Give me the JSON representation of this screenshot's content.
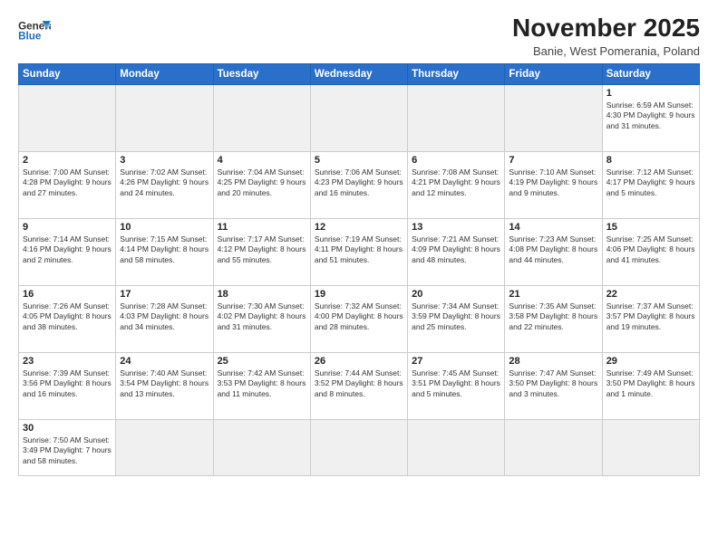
{
  "header": {
    "logo_text_regular": "General",
    "logo_text_blue": "Blue",
    "title": "November 2025",
    "subtitle": "Banie, West Pomerania, Poland"
  },
  "weekdays": [
    "Sunday",
    "Monday",
    "Tuesday",
    "Wednesday",
    "Thursday",
    "Friday",
    "Saturday"
  ],
  "weeks": [
    [
      {
        "day": "",
        "info": ""
      },
      {
        "day": "",
        "info": ""
      },
      {
        "day": "",
        "info": ""
      },
      {
        "day": "",
        "info": ""
      },
      {
        "day": "",
        "info": ""
      },
      {
        "day": "",
        "info": ""
      },
      {
        "day": "1",
        "info": "Sunrise: 6:59 AM\nSunset: 4:30 PM\nDaylight: 9 hours\nand 31 minutes."
      }
    ],
    [
      {
        "day": "2",
        "info": "Sunrise: 7:00 AM\nSunset: 4:28 PM\nDaylight: 9 hours\nand 27 minutes."
      },
      {
        "day": "3",
        "info": "Sunrise: 7:02 AM\nSunset: 4:26 PM\nDaylight: 9 hours\nand 24 minutes."
      },
      {
        "day": "4",
        "info": "Sunrise: 7:04 AM\nSunset: 4:25 PM\nDaylight: 9 hours\nand 20 minutes."
      },
      {
        "day": "5",
        "info": "Sunrise: 7:06 AM\nSunset: 4:23 PM\nDaylight: 9 hours\nand 16 minutes."
      },
      {
        "day": "6",
        "info": "Sunrise: 7:08 AM\nSunset: 4:21 PM\nDaylight: 9 hours\nand 12 minutes."
      },
      {
        "day": "7",
        "info": "Sunrise: 7:10 AM\nSunset: 4:19 PM\nDaylight: 9 hours\nand 9 minutes."
      },
      {
        "day": "8",
        "info": "Sunrise: 7:12 AM\nSunset: 4:17 PM\nDaylight: 9 hours\nand 5 minutes."
      }
    ],
    [
      {
        "day": "9",
        "info": "Sunrise: 7:14 AM\nSunset: 4:16 PM\nDaylight: 9 hours\nand 2 minutes."
      },
      {
        "day": "10",
        "info": "Sunrise: 7:15 AM\nSunset: 4:14 PM\nDaylight: 8 hours\nand 58 minutes."
      },
      {
        "day": "11",
        "info": "Sunrise: 7:17 AM\nSunset: 4:12 PM\nDaylight: 8 hours\nand 55 minutes."
      },
      {
        "day": "12",
        "info": "Sunrise: 7:19 AM\nSunset: 4:11 PM\nDaylight: 8 hours\nand 51 minutes."
      },
      {
        "day": "13",
        "info": "Sunrise: 7:21 AM\nSunset: 4:09 PM\nDaylight: 8 hours\nand 48 minutes."
      },
      {
        "day": "14",
        "info": "Sunrise: 7:23 AM\nSunset: 4:08 PM\nDaylight: 8 hours\nand 44 minutes."
      },
      {
        "day": "15",
        "info": "Sunrise: 7:25 AM\nSunset: 4:06 PM\nDaylight: 8 hours\nand 41 minutes."
      }
    ],
    [
      {
        "day": "16",
        "info": "Sunrise: 7:26 AM\nSunset: 4:05 PM\nDaylight: 8 hours\nand 38 minutes."
      },
      {
        "day": "17",
        "info": "Sunrise: 7:28 AM\nSunset: 4:03 PM\nDaylight: 8 hours\nand 34 minutes."
      },
      {
        "day": "18",
        "info": "Sunrise: 7:30 AM\nSunset: 4:02 PM\nDaylight: 8 hours\nand 31 minutes."
      },
      {
        "day": "19",
        "info": "Sunrise: 7:32 AM\nSunset: 4:00 PM\nDaylight: 8 hours\nand 28 minutes."
      },
      {
        "day": "20",
        "info": "Sunrise: 7:34 AM\nSunset: 3:59 PM\nDaylight: 8 hours\nand 25 minutes."
      },
      {
        "day": "21",
        "info": "Sunrise: 7:35 AM\nSunset: 3:58 PM\nDaylight: 8 hours\nand 22 minutes."
      },
      {
        "day": "22",
        "info": "Sunrise: 7:37 AM\nSunset: 3:57 PM\nDaylight: 8 hours\nand 19 minutes."
      }
    ],
    [
      {
        "day": "23",
        "info": "Sunrise: 7:39 AM\nSunset: 3:56 PM\nDaylight: 8 hours\nand 16 minutes."
      },
      {
        "day": "24",
        "info": "Sunrise: 7:40 AM\nSunset: 3:54 PM\nDaylight: 8 hours\nand 13 minutes."
      },
      {
        "day": "25",
        "info": "Sunrise: 7:42 AM\nSunset: 3:53 PM\nDaylight: 8 hours\nand 11 minutes."
      },
      {
        "day": "26",
        "info": "Sunrise: 7:44 AM\nSunset: 3:52 PM\nDaylight: 8 hours\nand 8 minutes."
      },
      {
        "day": "27",
        "info": "Sunrise: 7:45 AM\nSunset: 3:51 PM\nDaylight: 8 hours\nand 5 minutes."
      },
      {
        "day": "28",
        "info": "Sunrise: 7:47 AM\nSunset: 3:50 PM\nDaylight: 8 hours\nand 3 minutes."
      },
      {
        "day": "29",
        "info": "Sunrise: 7:49 AM\nSunset: 3:50 PM\nDaylight: 8 hours\nand 1 minute."
      }
    ],
    [
      {
        "day": "30",
        "info": "Sunrise: 7:50 AM\nSunset: 3:49 PM\nDaylight: 7 hours\nand 58 minutes."
      },
      {
        "day": "",
        "info": ""
      },
      {
        "day": "",
        "info": ""
      },
      {
        "day": "",
        "info": ""
      },
      {
        "day": "",
        "info": ""
      },
      {
        "day": "",
        "info": ""
      },
      {
        "day": "",
        "info": ""
      }
    ]
  ]
}
